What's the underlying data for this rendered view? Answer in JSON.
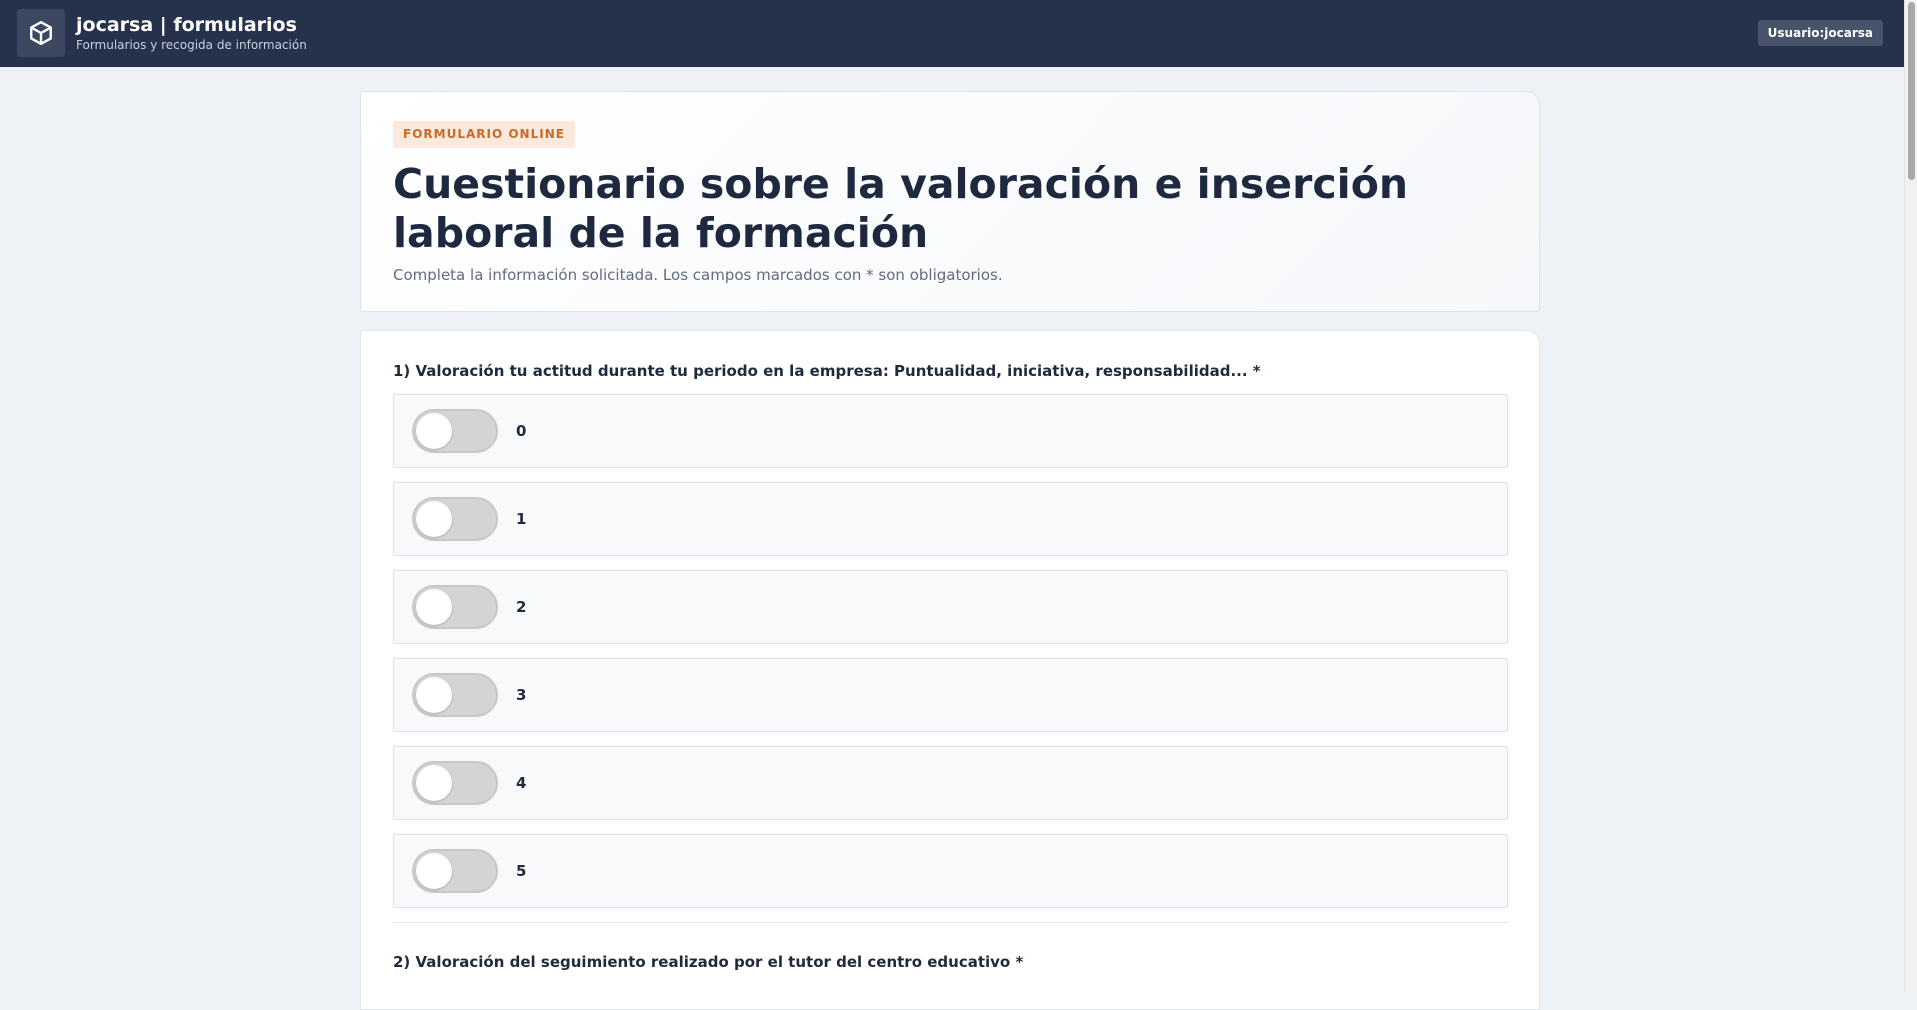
{
  "header": {
    "brand_title": "jocarsa | formularios",
    "brand_subtitle": "Formularios y recogida de información",
    "user_label": "Usuario:jocarsa",
    "logo_icon": "cube-icon"
  },
  "hero": {
    "tag": "FORMULARIO ONLINE",
    "title": "Cuestionario sobre la valoración e inserción laboral de la formación",
    "description": "Completa la información solicitada. Los campos marcados con * son obligatorios."
  },
  "questions": [
    {
      "label": "1) Valoración tu actitud durante tu periodo en la empresa: Puntualidad, iniciativa, responsabilidad... *",
      "options": [
        {
          "label": "0",
          "checked": false
        },
        {
          "label": "1",
          "checked": false
        },
        {
          "label": "2",
          "checked": false
        },
        {
          "label": "3",
          "checked": false
        },
        {
          "label": "4",
          "checked": false
        },
        {
          "label": "5",
          "checked": false
        }
      ]
    },
    {
      "label": "2) Valoración del seguimiento realizado por el tutor del centro educativo *"
    }
  ],
  "colors": {
    "topbar": "#26324b",
    "tag_bg": "#fbe9dd",
    "tag_text": "#c96a27",
    "page_bg": "#eef1f5"
  }
}
